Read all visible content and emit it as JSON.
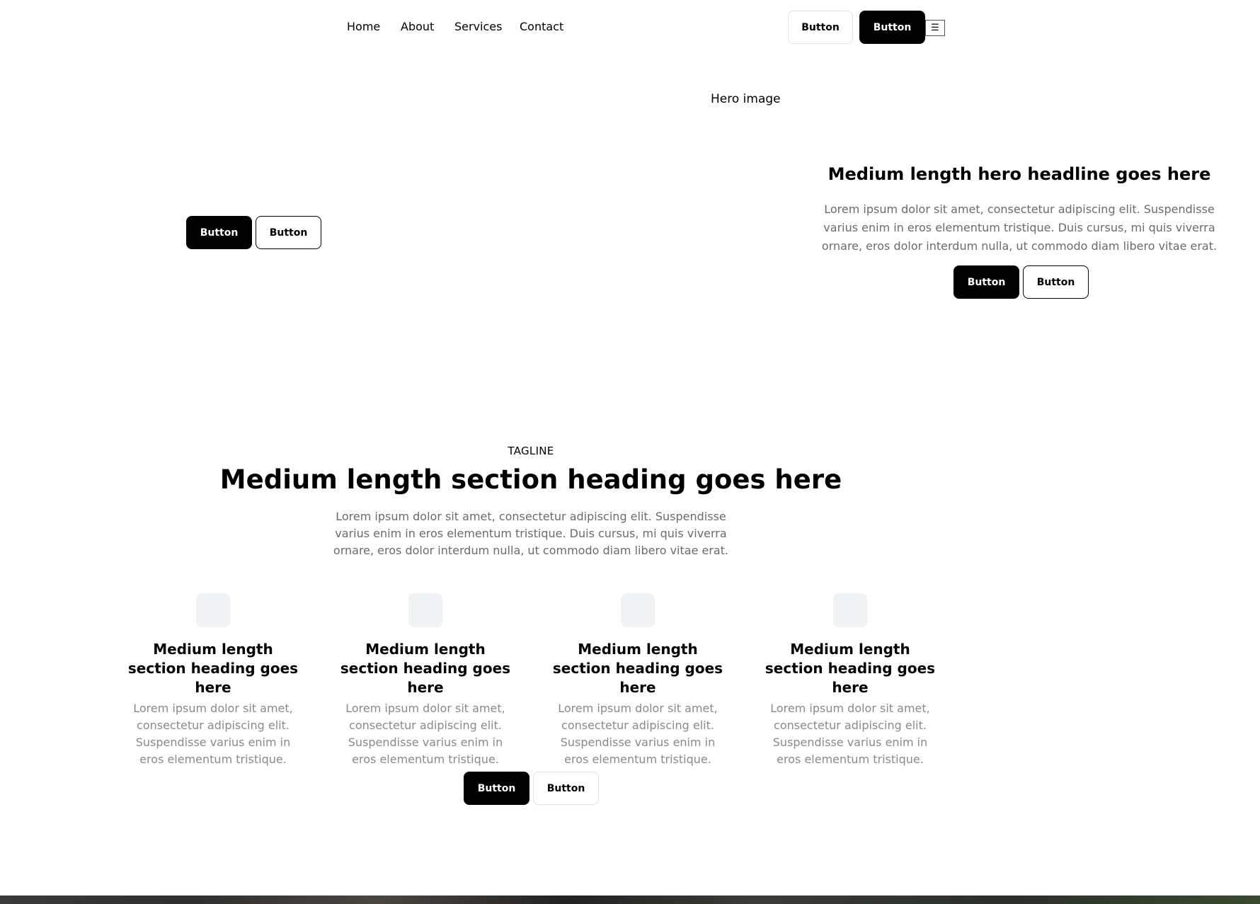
{
  "nav": {
    "links": [
      "Home",
      "About",
      "Services",
      "Contact"
    ],
    "secondary_button": "Button",
    "primary_button": "Button",
    "menu_icon": "☰"
  },
  "hero": {
    "left_primary_button": "Button",
    "left_secondary_button": "Button",
    "image_alt": "Hero image",
    "headline": "Medium length hero headline goes here",
    "text": "Lorem ipsum dolor sit amet, consectetur adipiscing elit. Suspendisse varius enim in eros elementum tristique. Duis cursus, mi quis viverra ornare, eros dolor interdum nulla, ut commodo diam libero vitae erat.",
    "primary_button": "Button",
    "secondary_button": "Button"
  },
  "section": {
    "tagline": "TAGLINE",
    "heading": "Medium length section heading goes here",
    "text": "Lorem ipsum dolor sit amet, consectetur adipiscing elit. Suspendisse varius enim in eros elementum tristique. Duis cursus, mi quis viverra ornare, eros dolor interdum nulla, ut commodo diam libero vitae erat.",
    "features": [
      {
        "heading": "Medium length section heading goes here",
        "text": "Lorem ipsum dolor sit amet, consectetur adipiscing elit. Suspendisse varius enim in eros elementum tristique."
      },
      {
        "heading": "Medium length section heading goes here",
        "text": "Lorem ipsum dolor sit amet, consectetur adipiscing elit. Suspendisse varius enim in eros elementum tristique."
      },
      {
        "heading": "Medium length section heading goes here",
        "text": "Lorem ipsum dolor sit amet, consectetur adipiscing elit. Suspendisse varius enim in eros elementum tristique."
      },
      {
        "heading": "Medium length section heading goes here",
        "text": "Lorem ipsum dolor sit amet, consectetur adipiscing elit. Suspendisse varius enim in eros elementum tristique."
      }
    ],
    "primary_button": "Button",
    "secondary_button": "Button"
  },
  "colors": {
    "primary": "#000000",
    "background": "#ffffff",
    "muted_text": "#6b6b6b",
    "icon_placeholder": "#f1f2f4"
  }
}
